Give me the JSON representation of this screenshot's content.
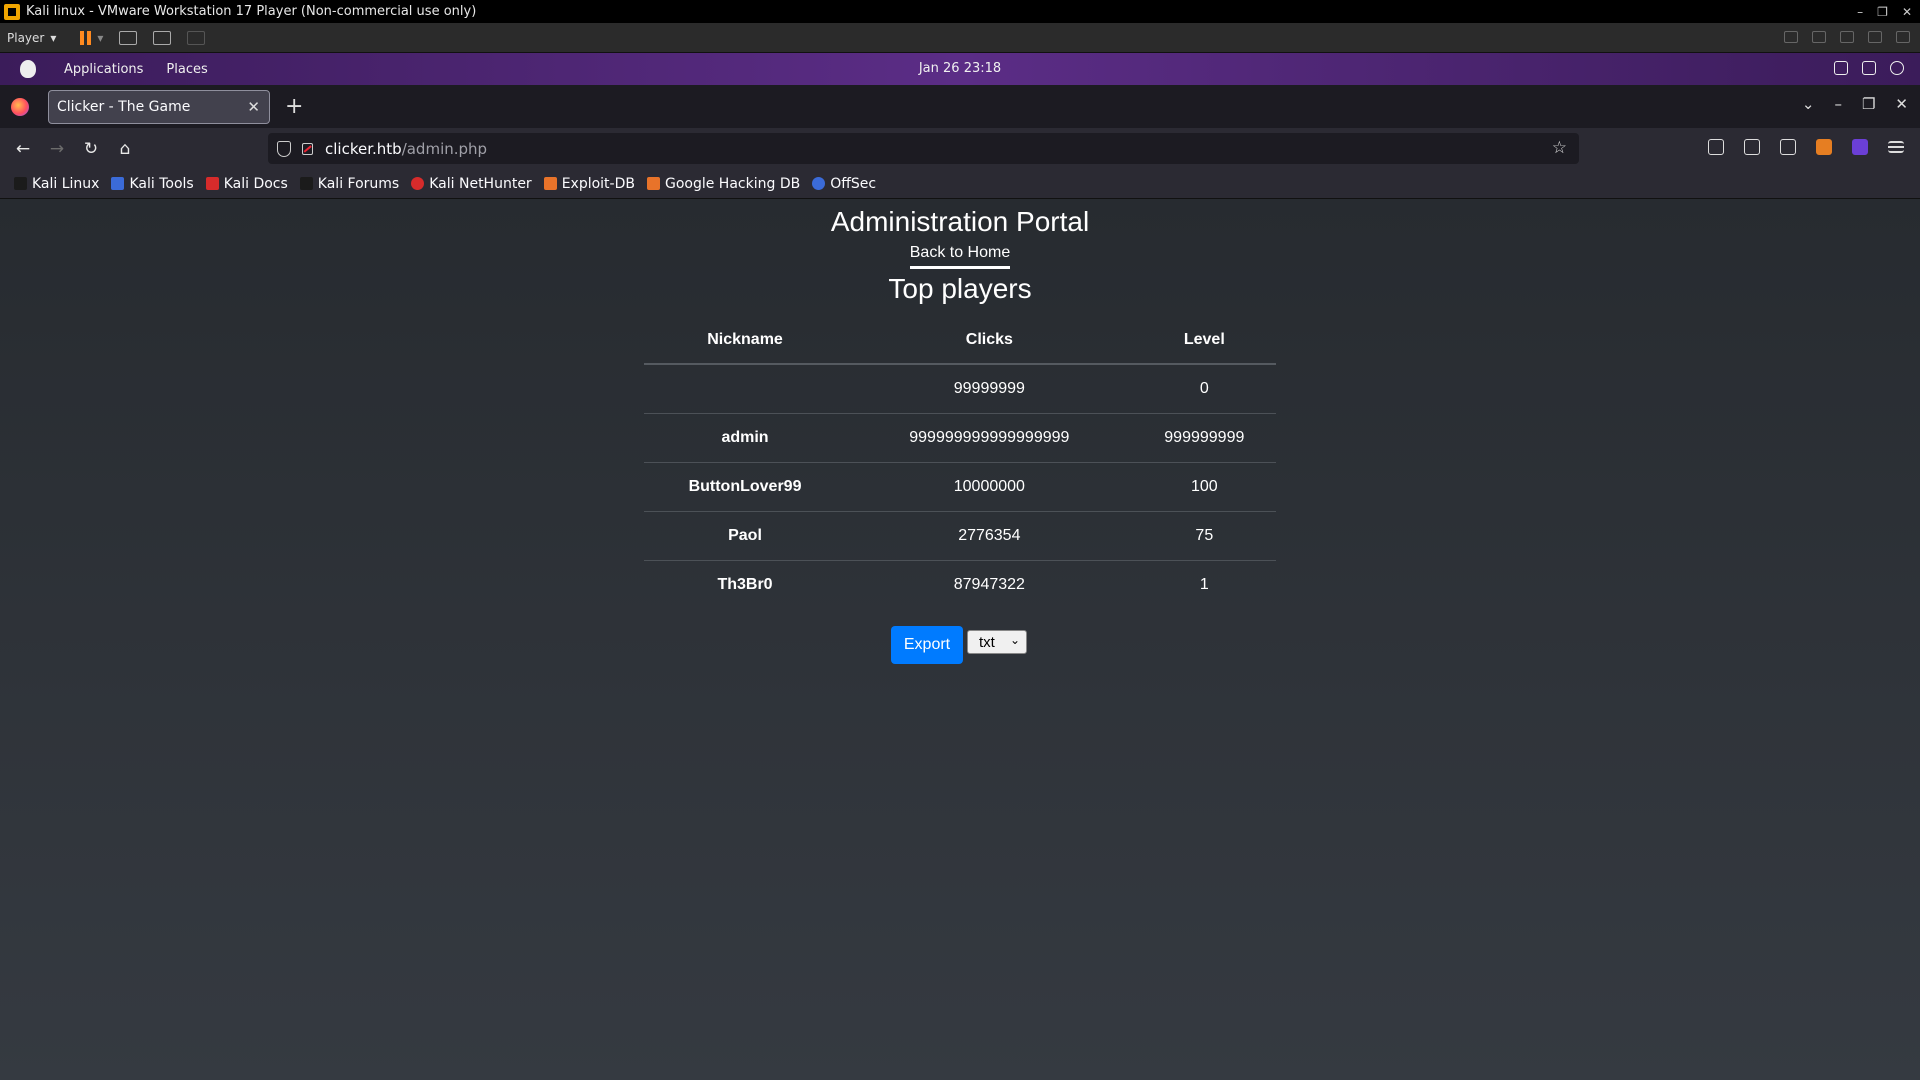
{
  "vm": {
    "title": "Kali linux - VMware Workstation 17 Player (Non-commercial use only)",
    "player_menu": "Player"
  },
  "desktop": {
    "applications": "Applications",
    "places": "Places",
    "clock": "Jan 26  23:18"
  },
  "browser": {
    "tab_title": "Clicker - The Game",
    "url_host": "clicker.htb",
    "url_path": "/admin.php",
    "bookmarks": [
      {
        "label": "Kali Linux",
        "color": "#1b1b1b"
      },
      {
        "label": "Kali Tools",
        "color": "#3b6bd8"
      },
      {
        "label": "Kali Docs",
        "color": "#d62b2b"
      },
      {
        "label": "Kali Forums",
        "color": "#1b1b1b"
      },
      {
        "label": "Kali NetHunter",
        "color": "#d62b2b"
      },
      {
        "label": "Exploit-DB",
        "color": "#e8732a"
      },
      {
        "label": "Google Hacking DB",
        "color": "#e8732a"
      },
      {
        "label": "OffSec",
        "color": "#3b6bd8"
      }
    ]
  },
  "page": {
    "title": "Administration Portal",
    "back_link": "Back to Home",
    "section_title": "Top players",
    "columns": [
      "Nickname",
      "Clicks",
      "Level"
    ],
    "rows": [
      {
        "nickname": "",
        "clicks": "99999999",
        "level": "0"
      },
      {
        "nickname": "admin",
        "clicks": "999999999999999999",
        "level": "999999999"
      },
      {
        "nickname": "ButtonLover99",
        "clicks": "10000000",
        "level": "100"
      },
      {
        "nickname": "Paol",
        "clicks": "2776354",
        "level": "75"
      },
      {
        "nickname": "Th3Br0",
        "clicks": "87947322",
        "level": "1"
      }
    ],
    "export_label": "Export",
    "export_format": "txt",
    "accent_color": "#007bff"
  }
}
